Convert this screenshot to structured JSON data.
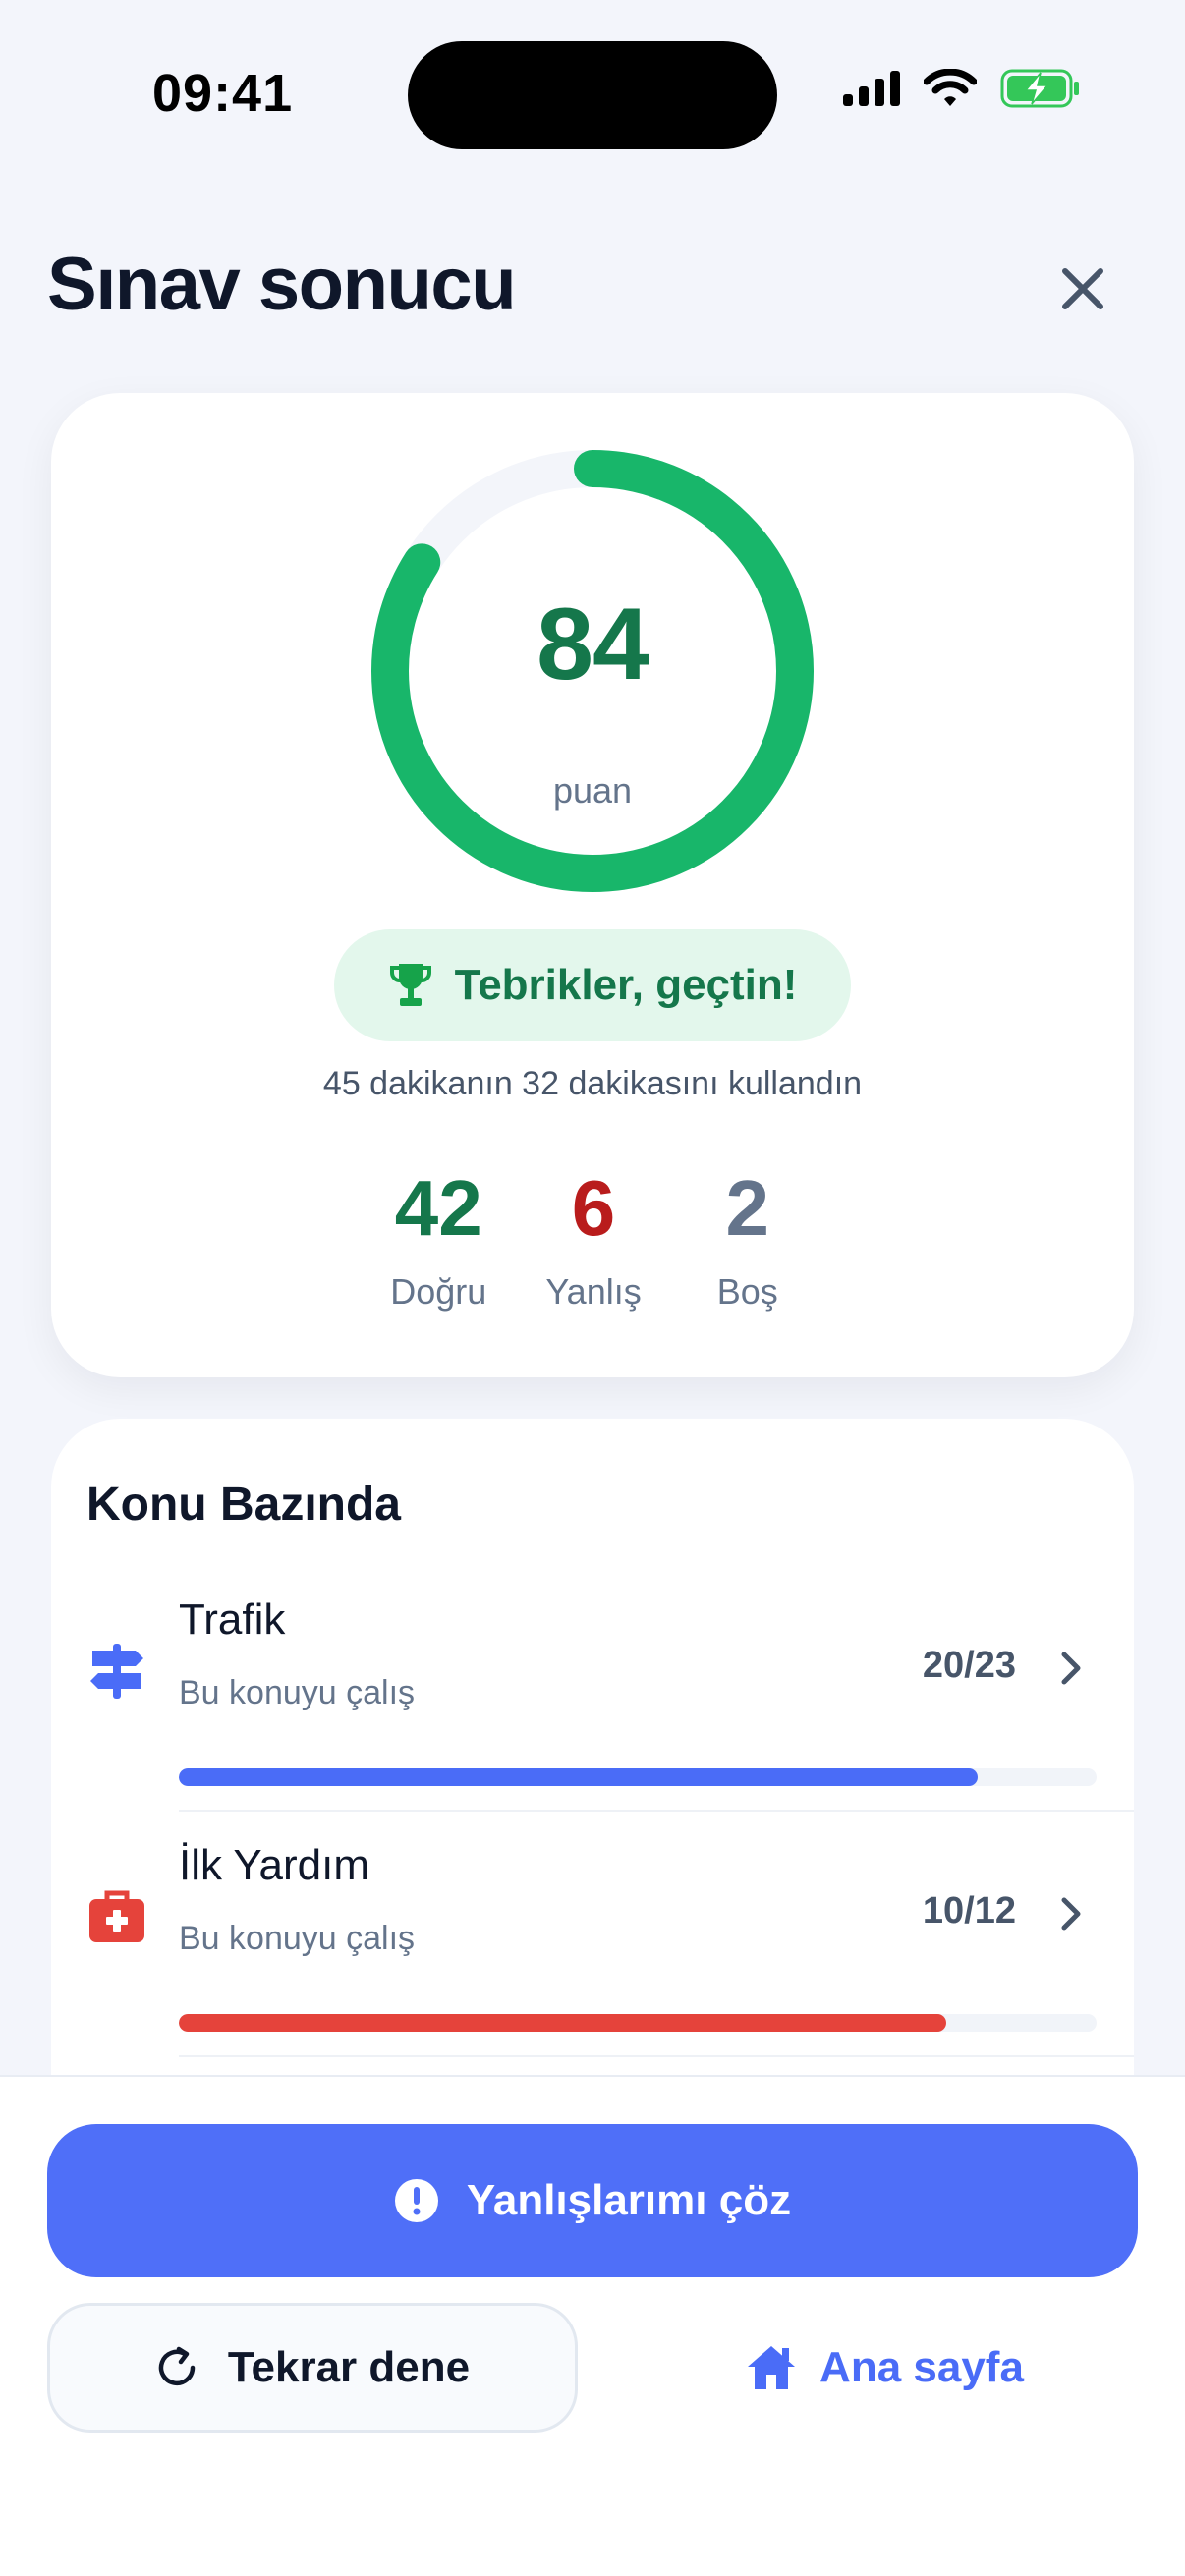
{
  "status_bar": {
    "time": "09:41"
  },
  "header": {
    "title": "Sınav sonucu",
    "close_icon": "close-icon"
  },
  "score_card": {
    "score": "84",
    "score_unit": "puan",
    "score_fraction": 0.84,
    "ring_color": "#18B66A",
    "badge_text": "Tebrikler, geçtin!",
    "badge_icon": "trophy-icon",
    "time_note": "45 dakikanın 32 dakikasını kullandın",
    "stats": {
      "correct_value": "42",
      "correct_label": "Doğru",
      "wrong_value": "6",
      "wrong_label": "Yanlış",
      "empty_value": "2",
      "empty_label": "Boş"
    }
  },
  "topics": {
    "heading": "Konu Bazında",
    "items": [
      {
        "name": "Trafik",
        "subtitle": "Bu konuyu çalış",
        "score": "20/23",
        "progress": 0.87,
        "icon": "signpost-icon",
        "color": "#4A6CF7"
      },
      {
        "name": "İlk Yardım",
        "subtitle": "Bu konuyu çalış",
        "score": "10/12",
        "progress": 0.836,
        "icon": "first-aid-kit-icon",
        "color": "#E5433B"
      }
    ]
  },
  "actions": {
    "primary_label": "Yanlışlarımı çöz",
    "primary_icon": "alert-circle-icon",
    "retry_label": "Tekrar dene",
    "retry_icon": "refresh-icon",
    "home_label": "Ana sayfa",
    "home_icon": "home-icon",
    "accent_color": "#4F6FF8"
  }
}
